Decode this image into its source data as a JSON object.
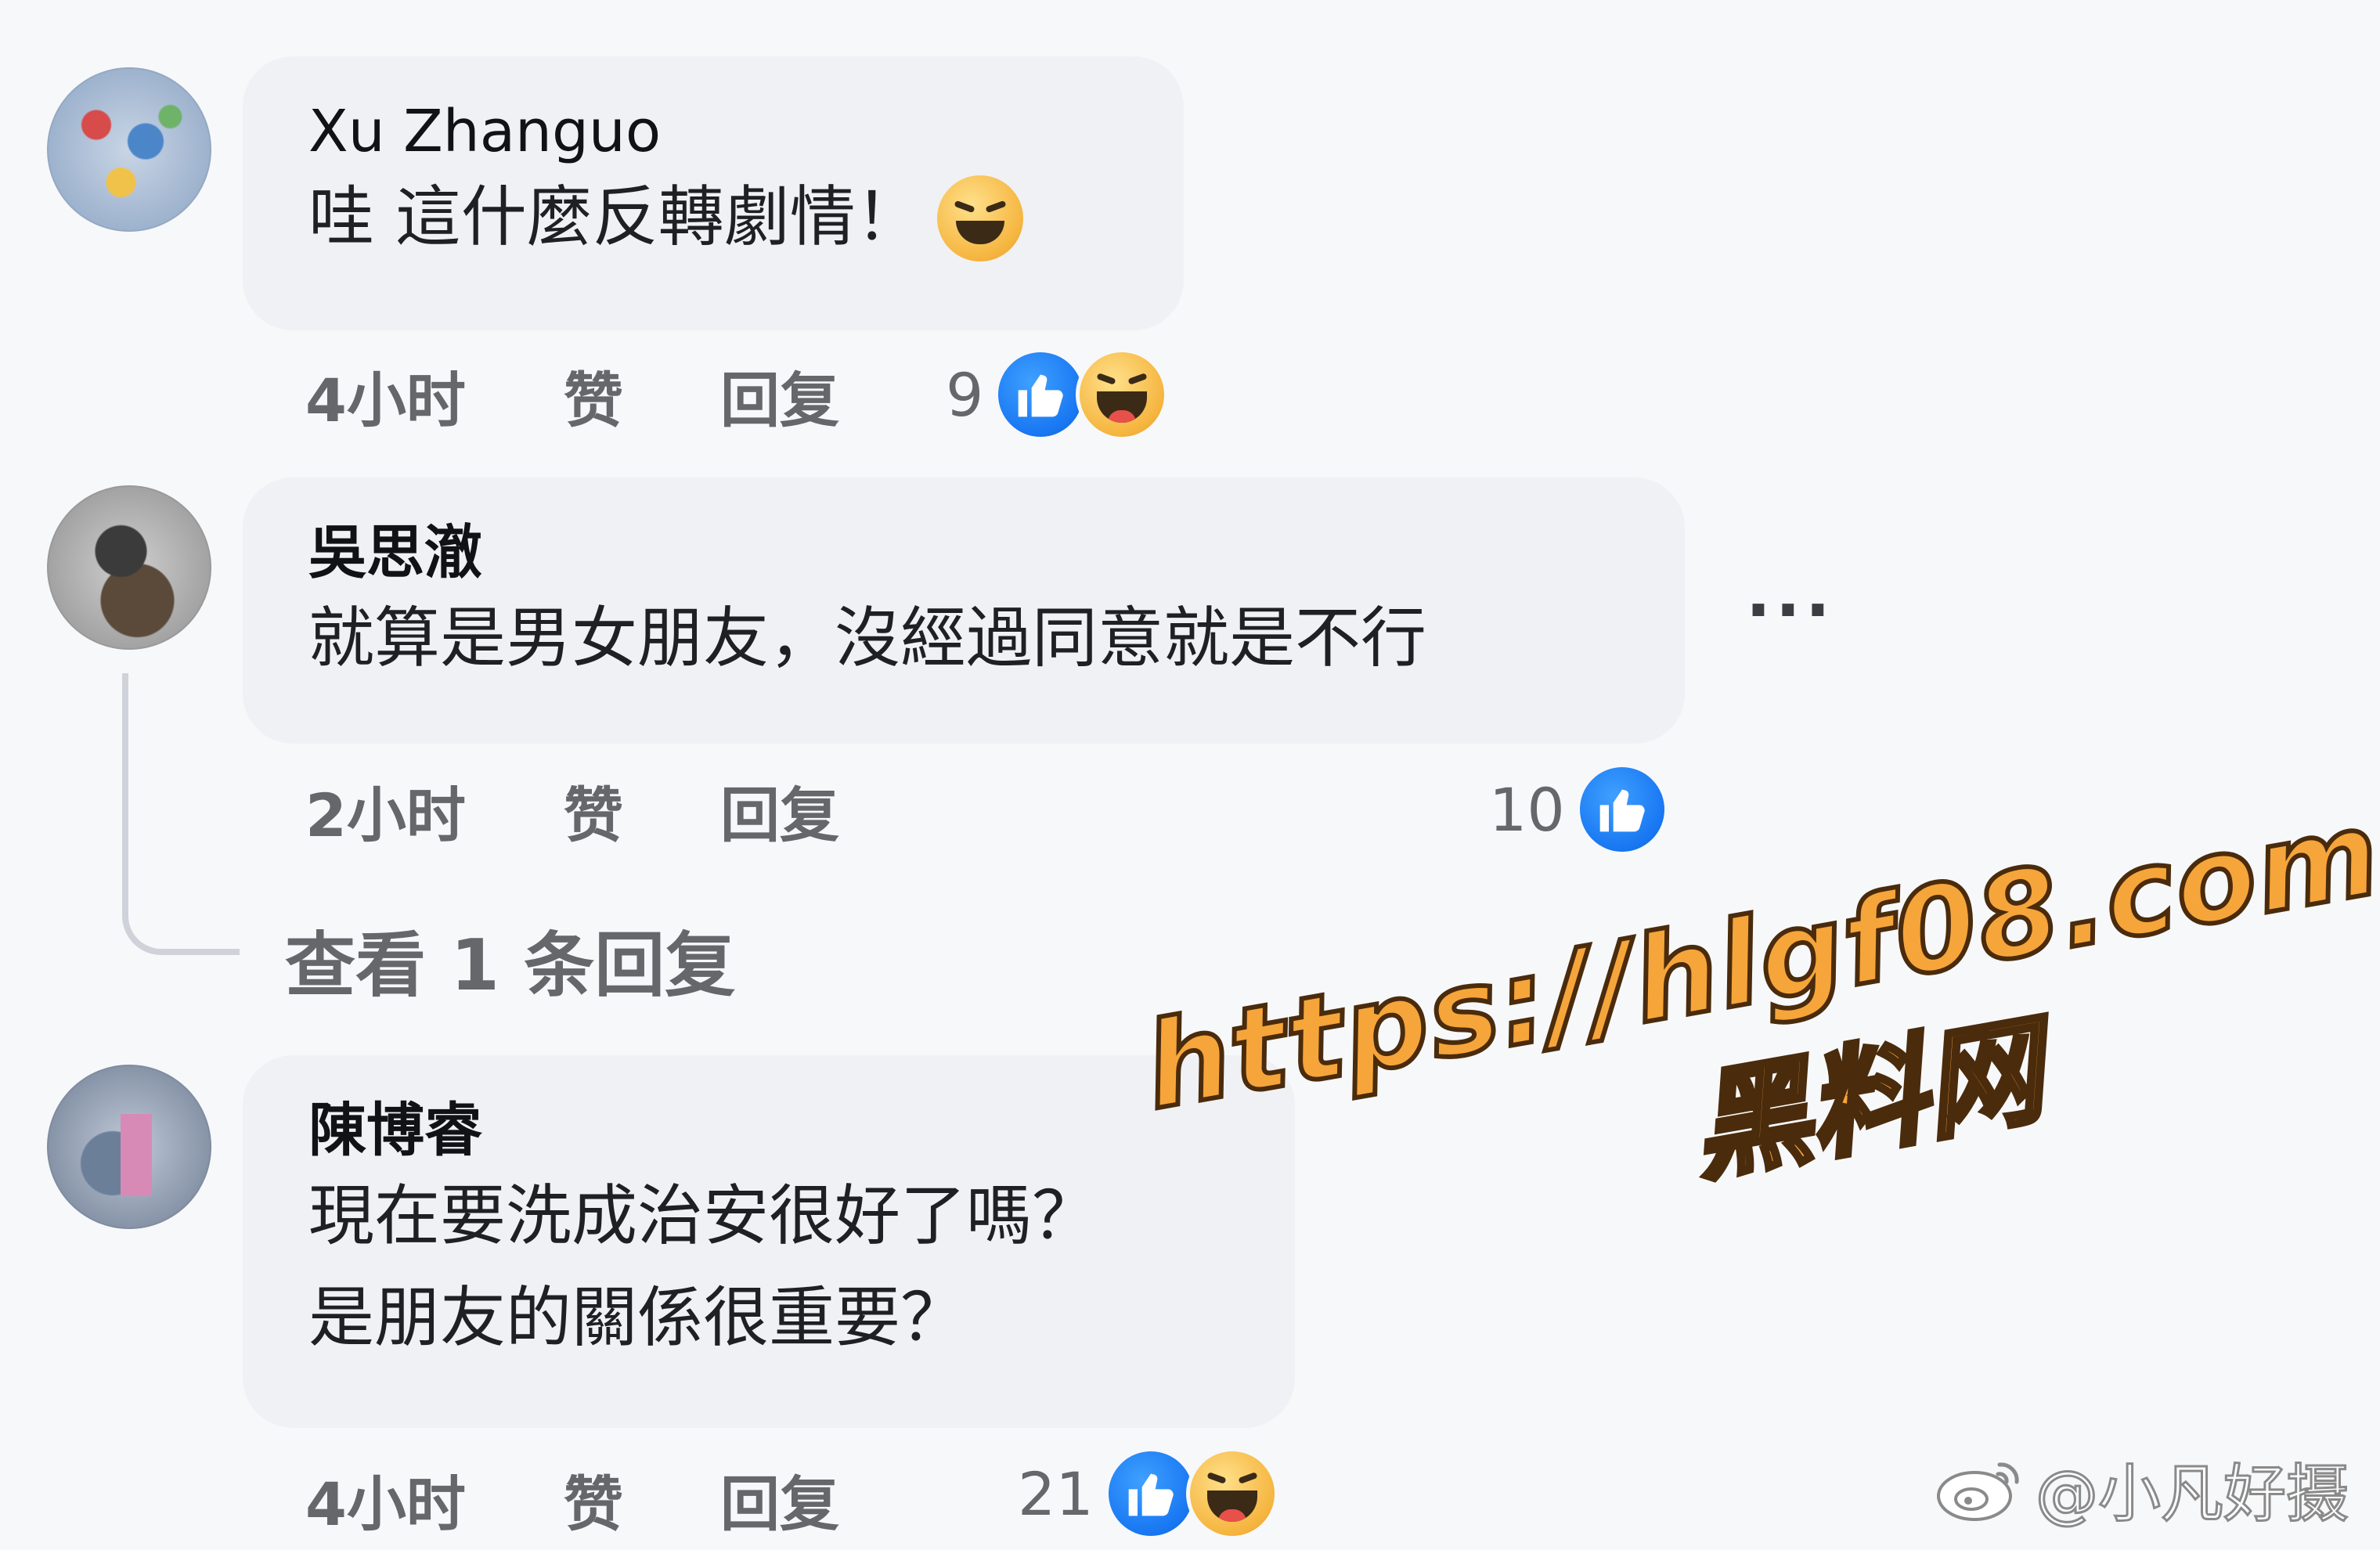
{
  "comments": [
    {
      "author": "Xu Zhanguo",
      "text": "哇 這什麼反轉劇情！",
      "emoji": "grinning-squinting-emoji",
      "time": "4小时",
      "like_label": "赞",
      "reply_label": "回复",
      "reaction_count": "9",
      "reactions": [
        "like",
        "haha"
      ]
    },
    {
      "author": "吳思澈",
      "text": "就算是男女朋友，沒經過同意就是不行",
      "time": "2小时",
      "like_label": "赞",
      "reply_label": "回复",
      "reaction_count": "10",
      "reactions": [
        "like"
      ],
      "more_label": "···"
    },
    {
      "author": "陳博睿",
      "text": "現在要洗成治安很好了嗎？\n是朋友的關係很重要？",
      "time": "4小时",
      "like_label": "赞",
      "reply_label": "回复",
      "reaction_count": "21",
      "reactions": [
        "like",
        "haha"
      ]
    }
  ],
  "view_replies": "查看 1 条回复",
  "watermark": {
    "url": "https://hlgf08.com",
    "site": "黑料网"
  },
  "weibo_handle": "@小凡好摄",
  "colors": {
    "background": "#f7f8fa",
    "bubble": "#eff1f4",
    "meta_text": "#65676b",
    "like_blue": "#1877f2",
    "watermark_orange": "#f6a53a"
  }
}
